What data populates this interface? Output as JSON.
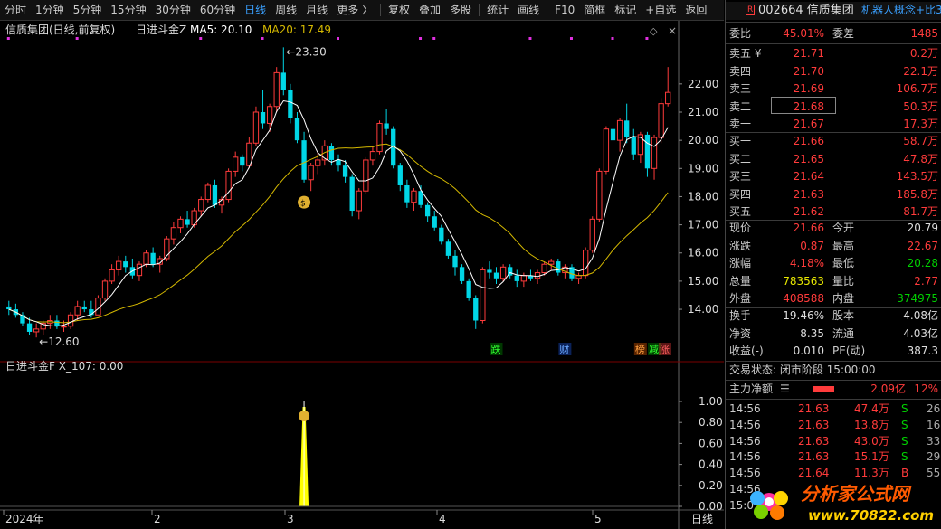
{
  "toolbar": {
    "items": [
      "分时",
      "1分钟",
      "5分钟",
      "15分钟",
      "30分钟",
      "60分钟",
      "日线",
      "周线",
      "月线",
      "更多 〉",
      "复权",
      "叠加",
      "多股",
      "统计",
      "画线",
      "F10",
      "简框",
      "标记",
      "+自选",
      "返回"
    ],
    "active_index": 6
  },
  "chart_data": [
    {
      "type": "candlestick",
      "title": "信质集团(日线,前复权)",
      "indicator_name": "日进斗金Z",
      "ma5_label": "MA5: 20.10",
      "ma20_label": "MA20: 17.49",
      "ylim": [
        12.3,
        23.6
      ],
      "y_ticks": [
        "22.00",
        "21.00",
        "20.00",
        "19.00",
        "18.00",
        "17.00",
        "16.00",
        "15.00",
        "14.00"
      ],
      "x_ticks": [
        "2024年",
        "2",
        "3",
        "4",
        "5",
        "日线"
      ],
      "high_label": "23.30",
      "low_label": "12.60",
      "annotations": [
        "跌",
        "财",
        "榜",
        "减",
        "涨"
      ],
      "candles": [
        [
          14.1,
          14.3,
          13.8,
          14.0
        ],
        [
          14.0,
          14.2,
          13.7,
          13.8
        ],
        [
          13.8,
          13.9,
          13.4,
          13.5
        ],
        [
          13.5,
          13.7,
          13.1,
          13.2
        ],
        [
          13.2,
          13.5,
          13.0,
          13.3
        ],
        [
          13.3,
          13.6,
          13.1,
          13.5
        ],
        [
          13.5,
          13.8,
          13.3,
          13.6
        ],
        [
          13.6,
          13.8,
          13.3,
          13.4
        ],
        [
          13.4,
          13.6,
          13.2,
          13.4
        ],
        [
          13.4,
          13.9,
          13.3,
          13.8
        ],
        [
          13.8,
          14.3,
          13.6,
          14.1
        ],
        [
          14.1,
          14.3,
          13.9,
          14.0
        ],
        [
          14.0,
          14.3,
          13.7,
          13.8
        ],
        [
          13.8,
          14.5,
          13.8,
          14.4
        ],
        [
          14.4,
          15.1,
          14.3,
          15.0
        ],
        [
          15.0,
          15.6,
          14.9,
          15.4
        ],
        [
          15.4,
          15.9,
          15.2,
          15.7
        ],
        [
          15.7,
          15.9,
          15.3,
          15.5
        ],
        [
          15.5,
          15.8,
          15.1,
          15.2
        ],
        [
          15.2,
          15.7,
          15.0,
          15.6
        ],
        [
          15.6,
          16.1,
          15.5,
          16.0
        ],
        [
          16.0,
          16.2,
          15.5,
          15.6
        ],
        [
          15.6,
          15.9,
          15.3,
          15.8
        ],
        [
          15.8,
          16.6,
          15.7,
          16.5
        ],
        [
          16.5,
          17.1,
          16.3,
          16.9
        ],
        [
          16.9,
          17.3,
          16.7,
          17.2
        ],
        [
          17.2,
          17.5,
          16.9,
          17.0
        ],
        [
          17.0,
          17.6,
          16.9,
          17.5
        ],
        [
          17.5,
          18.0,
          17.3,
          17.9
        ],
        [
          17.9,
          18.5,
          17.8,
          18.4
        ],
        [
          18.4,
          18.6,
          17.6,
          17.7
        ],
        [
          17.7,
          18.0,
          17.4,
          17.9
        ],
        [
          17.9,
          19.0,
          17.8,
          18.9
        ],
        [
          18.9,
          19.6,
          18.7,
          19.4
        ],
        [
          19.4,
          19.5,
          18.9,
          19.1
        ],
        [
          19.1,
          20.1,
          19.0,
          19.9
        ],
        [
          19.9,
          21.2,
          19.8,
          21.0
        ],
        [
          21.0,
          21.8,
          20.4,
          20.6
        ],
        [
          20.6,
          21.3,
          20.3,
          21.2
        ],
        [
          21.2,
          22.6,
          21.0,
          22.4
        ],
        [
          22.4,
          23.3,
          21.6,
          21.8
        ],
        [
          21.8,
          22.0,
          20.6,
          20.8
        ],
        [
          20.8,
          21.0,
          19.9,
          20.0
        ],
        [
          20.0,
          20.3,
          18.5,
          18.6
        ],
        [
          18.6,
          19.2,
          18.2,
          19.1
        ],
        [
          19.1,
          19.6,
          18.8,
          19.3
        ],
        [
          19.3,
          20.0,
          19.1,
          19.8
        ],
        [
          19.8,
          19.9,
          19.1,
          19.3
        ],
        [
          19.3,
          19.5,
          18.9,
          19.1
        ],
        [
          19.1,
          19.3,
          18.5,
          18.7
        ],
        [
          18.7,
          18.8,
          17.3,
          17.5
        ],
        [
          17.5,
          18.3,
          17.2,
          18.2
        ],
        [
          18.2,
          19.4,
          18.1,
          19.3
        ],
        [
          19.3,
          19.8,
          19.1,
          19.6
        ],
        [
          19.6,
          20.7,
          19.5,
          20.6
        ],
        [
          20.6,
          21.1,
          20.2,
          20.4
        ],
        [
          20.4,
          20.5,
          19.0,
          19.1
        ],
        [
          19.1,
          19.2,
          18.2,
          18.4
        ],
        [
          18.4,
          18.6,
          17.6,
          17.8
        ],
        [
          17.8,
          18.3,
          17.5,
          18.2
        ],
        [
          18.2,
          18.4,
          17.6,
          17.7
        ],
        [
          17.7,
          17.8,
          17.1,
          17.3
        ],
        [
          17.3,
          17.5,
          16.8,
          16.9
        ],
        [
          16.9,
          17.0,
          16.3,
          16.4
        ],
        [
          16.4,
          16.5,
          15.8,
          15.9
        ],
        [
          15.9,
          16.1,
          15.2,
          15.5
        ],
        [
          15.5,
          15.6,
          14.9,
          15.0
        ],
        [
          15.0,
          15.1,
          14.3,
          14.4
        ],
        [
          14.4,
          14.5,
          13.3,
          13.6
        ],
        [
          13.6,
          15.5,
          13.5,
          15.4
        ],
        [
          15.4,
          15.7,
          15.1,
          15.3
        ],
        [
          15.3,
          15.5,
          14.9,
          15.1
        ],
        [
          15.1,
          15.6,
          15.0,
          15.5
        ],
        [
          15.5,
          15.6,
          15.1,
          15.2
        ],
        [
          15.2,
          15.4,
          14.8,
          15.0
        ],
        [
          15.0,
          15.3,
          14.8,
          15.2
        ],
        [
          15.2,
          15.4,
          15.0,
          15.1
        ],
        [
          15.1,
          15.4,
          14.9,
          15.3
        ],
        [
          15.3,
          15.7,
          15.2,
          15.6
        ],
        [
          15.6,
          15.8,
          15.4,
          15.7
        ],
        [
          15.7,
          15.8,
          15.2,
          15.3
        ],
        [
          15.3,
          15.6,
          15.1,
          15.5
        ],
        [
          15.5,
          15.6,
          15.0,
          15.1
        ],
        [
          15.1,
          15.3,
          14.9,
          15.2
        ],
        [
          15.2,
          16.2,
          15.1,
          16.1
        ],
        [
          16.1,
          17.3,
          16.0,
          17.2
        ],
        [
          17.2,
          19.0,
          17.1,
          18.9
        ],
        [
          18.9,
          20.5,
          18.8,
          20.4
        ],
        [
          20.4,
          21.0,
          19.8,
          20.0
        ],
        [
          20.0,
          20.8,
          19.6,
          20.7
        ],
        [
          20.7,
          21.3,
          19.9,
          20.1
        ],
        [
          20.1,
          20.4,
          19.3,
          19.5
        ],
        [
          19.5,
          20.3,
          19.2,
          20.2
        ],
        [
          20.2,
          20.3,
          18.7,
          19.0
        ],
        [
          19.0,
          20.2,
          18.6,
          20.1
        ],
        [
          20.1,
          21.5,
          19.9,
          21.3
        ],
        [
          21.3,
          22.6,
          21.2,
          21.7
        ]
      ]
    },
    {
      "type": "line",
      "indicator_label": "日进斗金F  X_107: 0.00",
      "ylim": [
        0,
        1.0
      ],
      "y_ticks": [
        "1.00",
        "0.80",
        "0.60",
        "0.40",
        "0.20",
        "0.00"
      ],
      "signal": {
        "candle_index": 43,
        "value": 1.0
      }
    }
  ],
  "side": {
    "title": "002664 信质集团",
    "concept": "机器人概念+比3",
    "weibi": {
      "label": "委比",
      "value": "45.01%",
      "label2": "委差",
      "value2": "1485"
    },
    "asks": [
      {
        "label": "卖五 ¥",
        "price": "21.71",
        "vol": "0.2万"
      },
      {
        "label": "卖四",
        "price": "21.70",
        "vol": "22.1万"
      },
      {
        "label": "卖三",
        "price": "21.69",
        "vol": "106.7万"
      },
      {
        "label": "卖二",
        "price": "21.68",
        "vol": "50.3万"
      },
      {
        "label": "卖一",
        "price": "21.67",
        "vol": "17.3万"
      }
    ],
    "bids": [
      {
        "label": "买一",
        "price": "21.66",
        "vol": "58.7万"
      },
      {
        "label": "买二",
        "price": "21.65",
        "vol": "47.8万"
      },
      {
        "label": "买三",
        "price": "21.64",
        "vol": "143.5万"
      },
      {
        "label": "买四",
        "price": "21.63",
        "vol": "185.8万"
      },
      {
        "label": "买五",
        "price": "21.62",
        "vol": "81.7万"
      }
    ],
    "stats": [
      {
        "l1": "现价",
        "v1": "21.66",
        "c1": "red",
        "l2": "今开",
        "v2": "20.79",
        "c2": "white"
      },
      {
        "l1": "涨跌",
        "v1": "0.87",
        "c1": "red",
        "l2": "最高",
        "v2": "22.67",
        "c2": "red"
      },
      {
        "l1": "涨幅",
        "v1": "4.18%",
        "c1": "red",
        "l2": "最低",
        "v2": "20.28",
        "c2": "green"
      },
      {
        "l1": "总量",
        "v1": "783563",
        "c1": "yellow",
        "l2": "量比",
        "v2": "2.77",
        "c2": "red"
      },
      {
        "l1": "外盘",
        "v1": "408588",
        "c1": "red",
        "l2": "内盘",
        "v2": "374975",
        "c2": "green"
      }
    ],
    "stats2": [
      {
        "l1": "换手",
        "v1": "19.46%",
        "l2": "股本",
        "v2": "4.08亿"
      },
      {
        "l1": "净资",
        "v1": "8.35",
        "l2": "流通",
        "v2": "4.03亿"
      },
      {
        "l1": "收益(-)",
        "v1": "0.010",
        "l2": "PE(动)",
        "v2": "387.3"
      }
    ],
    "trade_status": "交易状态: 闭市阶段 15:00:00",
    "main_flow": {
      "label": "主力净额",
      "value": "2.09亿",
      "pct": "12%"
    },
    "ticks": [
      {
        "t": "14:56",
        "p": "21.63",
        "v": "47.4万",
        "s": "S",
        "n": "26"
      },
      {
        "t": "14:56",
        "p": "21.63",
        "v": "13.8万",
        "s": "S",
        "n": "16"
      },
      {
        "t": "14:56",
        "p": "21.63",
        "v": "43.0万",
        "s": "S",
        "n": "33"
      },
      {
        "t": "14:56",
        "p": "21.63",
        "v": "15.1万",
        "s": "S",
        "n": "29"
      },
      {
        "t": "14:56",
        "p": "21.64",
        "v": "11.3万",
        "s": "B",
        "n": "55"
      },
      {
        "t": "14:56",
        "p": "",
        "v": "",
        "s": "",
        "n": ""
      },
      {
        "t": "15:0",
        "p": "",
        "v": "",
        "s": "",
        "n": ""
      }
    ],
    "watermark": "分析家公式网",
    "watermark_url": "www.70822.com"
  },
  "colors": {
    "up": "#ff3b3b",
    "down": "#00d6e6",
    "ma5": "#ffffff",
    "ma20": "#d4b800",
    "signal": "#ffff00",
    "accent": "#3aa0ff"
  }
}
